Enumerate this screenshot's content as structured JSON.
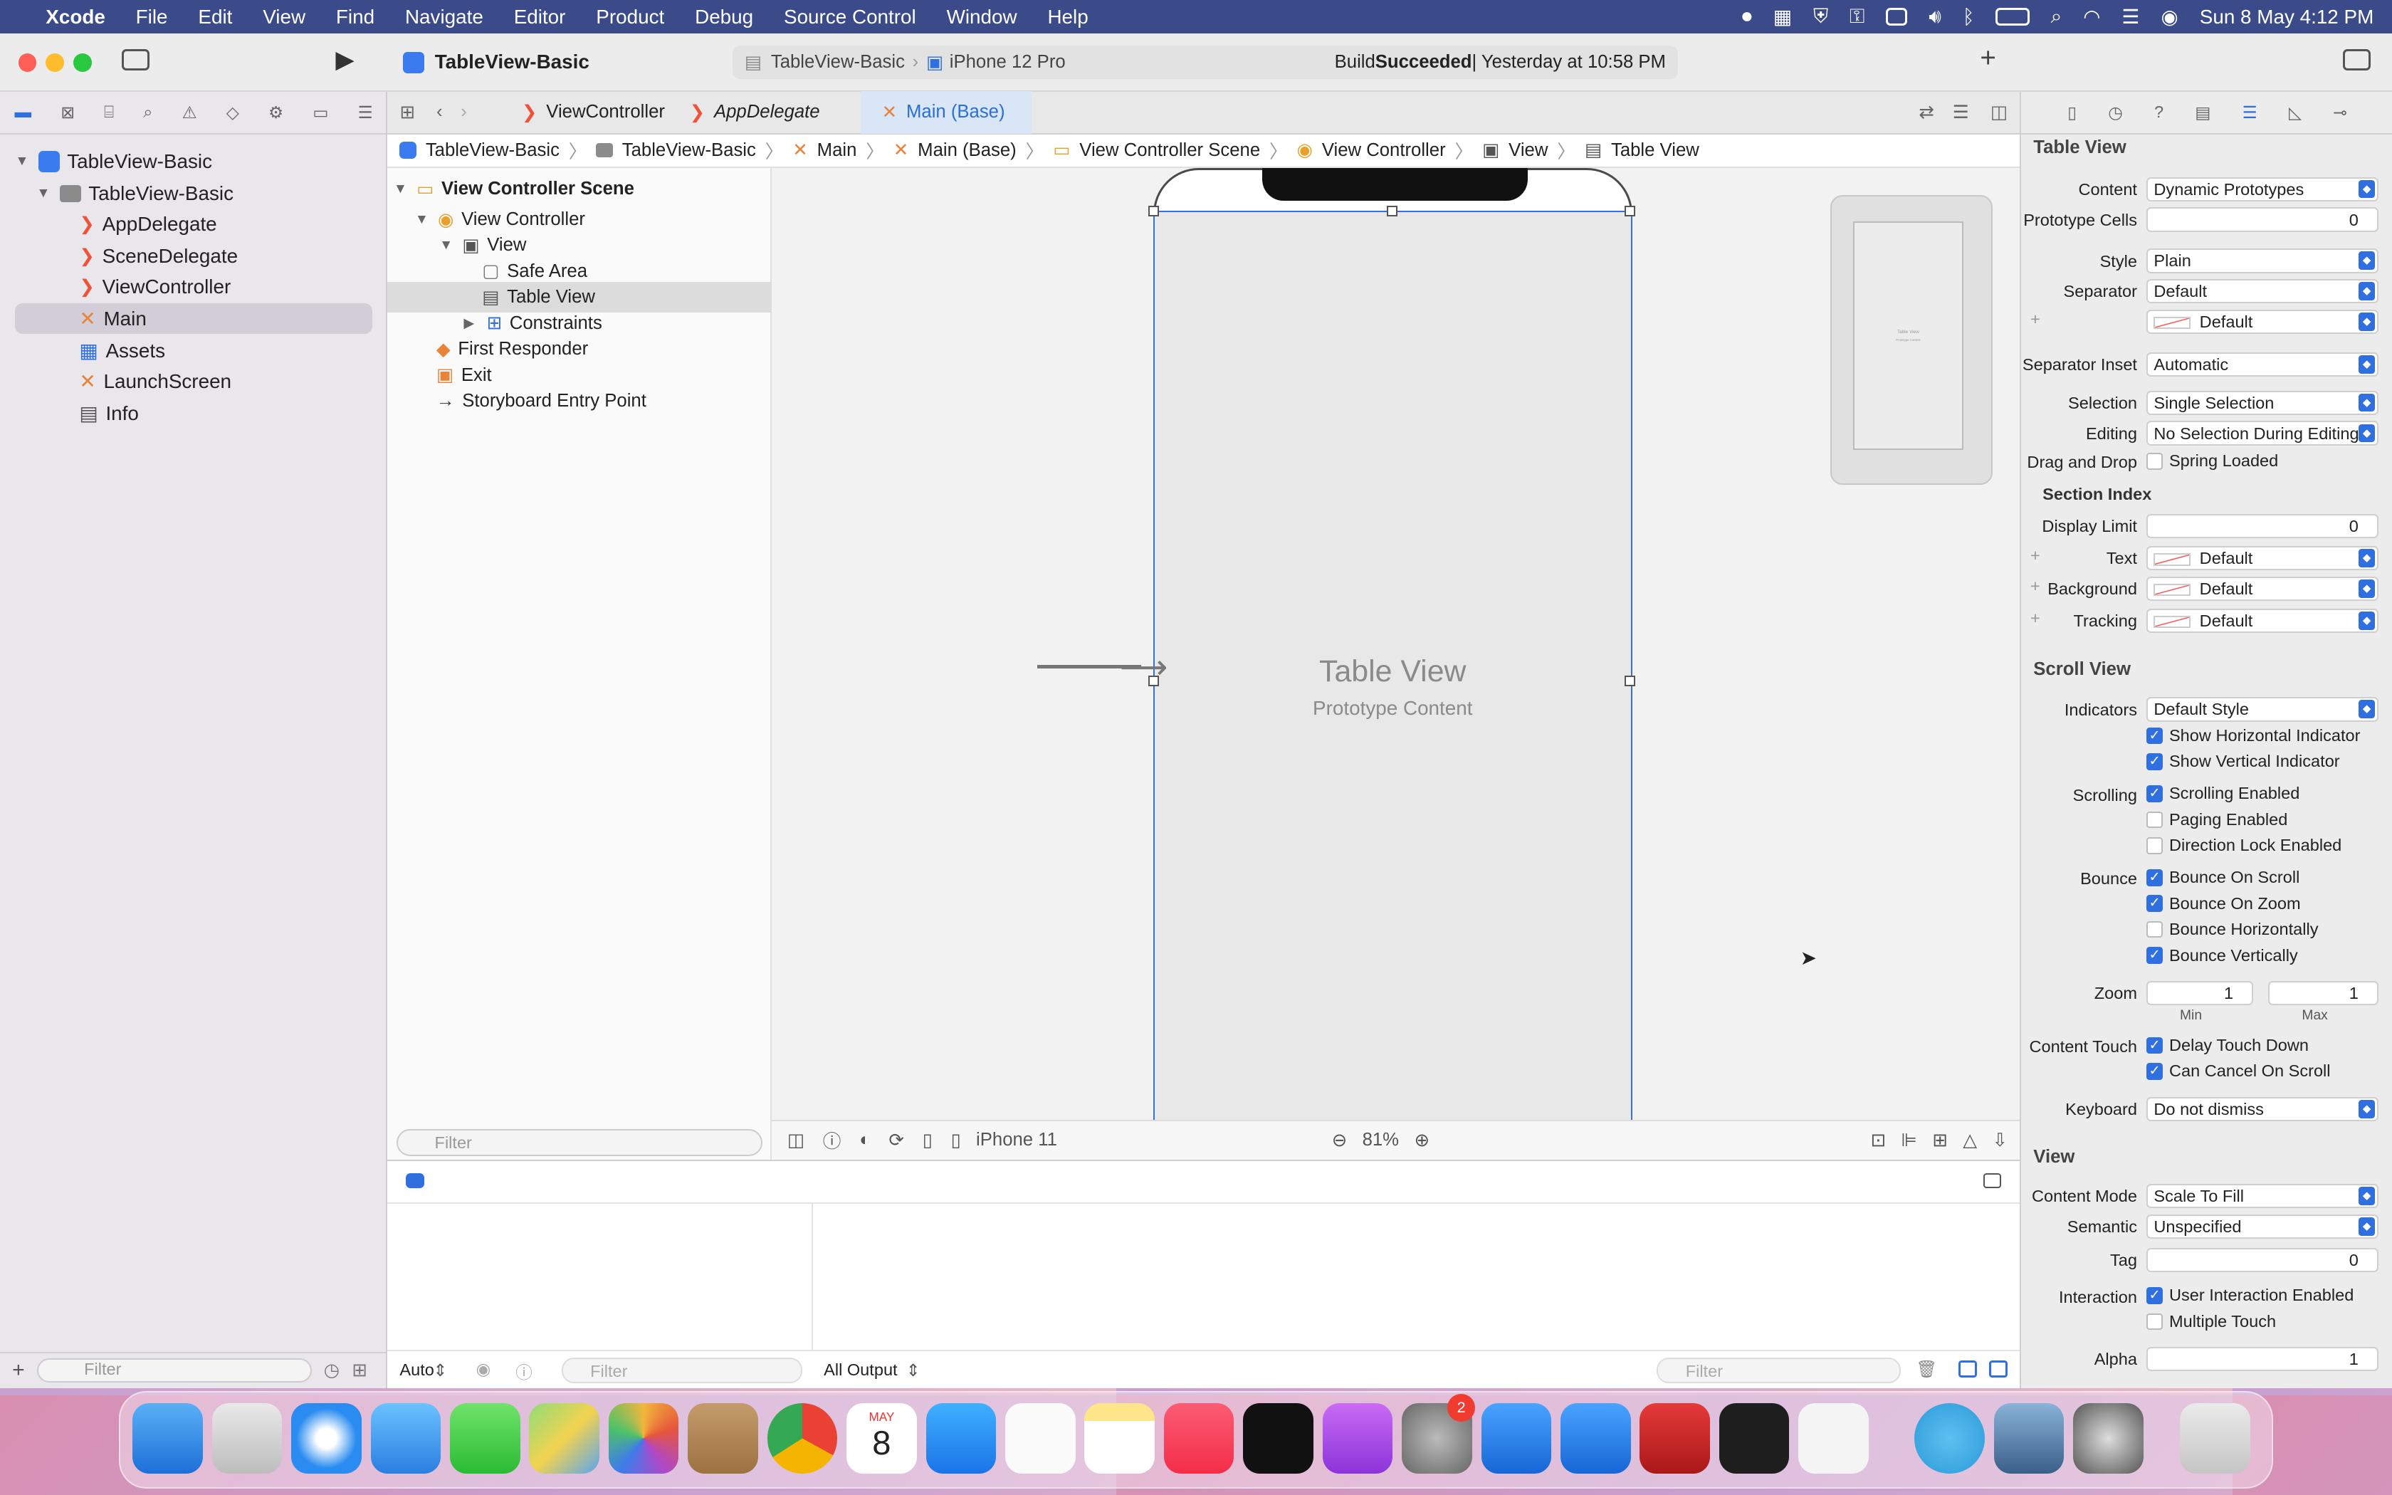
{
  "menubar": {
    "apple": "",
    "app_name": "Xcode",
    "items": [
      "File",
      "Edit",
      "View",
      "Find",
      "Navigate",
      "Editor",
      "Product",
      "Debug",
      "Source Control",
      "Window",
      "Help"
    ],
    "clock": "Sun 8 May  4:12 PM"
  },
  "toolbar": {
    "project_title": "TableView-Basic",
    "scheme": "TableView-Basic",
    "device": "iPhone 12 Pro",
    "status_prefix": "Build ",
    "status_bold": "Succeeded",
    "status_time": " | Yesterday at 10:58 PM",
    "add_label": "+"
  },
  "navigator": {
    "items": [
      {
        "label": "TableView-Basic",
        "icon": "project-icon",
        "level": 0
      },
      {
        "label": "TableView-Basic",
        "icon": "folder-icon",
        "level": 1
      },
      {
        "label": "AppDelegate",
        "icon": "swift-file-icon",
        "level": 2
      },
      {
        "label": "SceneDelegate",
        "icon": "swift-file-icon",
        "level": 2
      },
      {
        "label": "ViewController",
        "icon": "swift-file-icon",
        "level": 2
      },
      {
        "label": "Main",
        "icon": "storyboard-icon",
        "level": 2,
        "selected": true
      },
      {
        "label": "Assets",
        "icon": "asset-catalog-icon",
        "level": 2
      },
      {
        "label": "LaunchScreen",
        "icon": "storyboard-icon",
        "level": 2
      },
      {
        "label": "Info",
        "icon": "plist-icon",
        "level": 2
      }
    ],
    "filter_placeholder": "Filter"
  },
  "tabs": [
    {
      "label": "ViewController",
      "active": false
    },
    {
      "label": "AppDelegate",
      "active": false
    },
    {
      "label": "Main (Base)",
      "active": true
    }
  ],
  "jumpbar": [
    "TableView-Basic",
    "TableView-Basic",
    "Main",
    "Main (Base)",
    "View Controller Scene",
    "View Controller",
    "View",
    "Table View"
  ],
  "outline": {
    "items": [
      {
        "label": "View Controller Scene",
        "bold": true,
        "level": 0
      },
      {
        "label": "View Controller",
        "level": 1
      },
      {
        "label": "View",
        "level": 2
      },
      {
        "label": "Safe Area",
        "level": 3
      },
      {
        "label": "Table View",
        "level": 3,
        "selected": true
      },
      {
        "label": "Constraints",
        "level": 3
      },
      {
        "label": "First Responder",
        "level": 1
      },
      {
        "label": "Exit",
        "level": 1
      },
      {
        "label": "Storyboard Entry Point",
        "level": 1
      }
    ],
    "filter_placeholder": "Filter"
  },
  "canvas": {
    "table_title": "Table View",
    "table_subtitle": "Prototype Content",
    "mini_title": "Table View",
    "mini_subtitle": "Prototype Content",
    "device_label": "iPhone 11",
    "zoom": "81%"
  },
  "debug": {
    "auto_label": "Auto",
    "filter_placeholder": "Filter",
    "output_label": "All Output",
    "filter2_placeholder": "Filter"
  },
  "inspector": {
    "table_view_header": "Table View",
    "content_label": "Content",
    "content_value": "Dynamic Prototypes",
    "prototype_cells_label": "Prototype Cells",
    "prototype_cells_value": "0",
    "style_label": "Style",
    "style_value": "Plain",
    "separator_label": "Separator",
    "separator_value": "Default",
    "separator_color_value": "Default",
    "separator_inset_label": "Separator Inset",
    "separator_inset_value": "Automatic",
    "selection_label": "Selection",
    "selection_value": "Single Selection",
    "editing_label": "Editing",
    "editing_value": "No Selection During Editing",
    "drag_drop_label": "Drag and Drop",
    "spring_loaded": "Spring Loaded",
    "section_index_header": "Section Index",
    "display_limit_label": "Display Limit",
    "display_limit_value": "0",
    "text_label": "Text",
    "text_value": "Default",
    "background_label": "Background",
    "background_value": "Default",
    "tracking_label": "Tracking",
    "tracking_value": "Default",
    "scroll_view_header": "Scroll View",
    "indicators_label": "Indicators",
    "indicators_value": "Default Style",
    "show_h": "Show Horizontal Indicator",
    "show_v": "Show Vertical Indicator",
    "scrolling_label": "Scrolling",
    "scrolling_enabled": "Scrolling Enabled",
    "paging_enabled": "Paging Enabled",
    "direction_lock": "Direction Lock Enabled",
    "bounce_label": "Bounce",
    "bounce_scroll": "Bounce On Scroll",
    "bounce_zoom": "Bounce On Zoom",
    "bounce_h": "Bounce Horizontally",
    "bounce_v": "Bounce Vertically",
    "zoom_label": "Zoom",
    "zoom_min": "1",
    "zoom_max": "1",
    "min_label": "Min",
    "max_label": "Max",
    "content_touch_label": "Content Touch",
    "delay_touch": "Delay Touch Down",
    "cancel_scroll": "Can Cancel On Scroll",
    "keyboard_label": "Keyboard",
    "keyboard_value": "Do not dismiss",
    "view_header": "View",
    "content_mode_label": "Content Mode",
    "content_mode_value": "Scale To Fill",
    "semantic_label": "Semantic",
    "semantic_value": "Unspecified",
    "tag_label": "Tag",
    "tag_value": "0",
    "interaction_label": "Interaction",
    "user_interaction": "User Interaction Enabled",
    "multiple_touch": "Multiple Touch",
    "alpha_label": "Alpha",
    "alpha_value": "1"
  },
  "dock": {
    "calendar_month": "MAY",
    "calendar_day": "8",
    "settings_badge": "2"
  },
  "colors": {
    "accent": "#2f6fe0",
    "menubar": "#3b4b8a"
  }
}
